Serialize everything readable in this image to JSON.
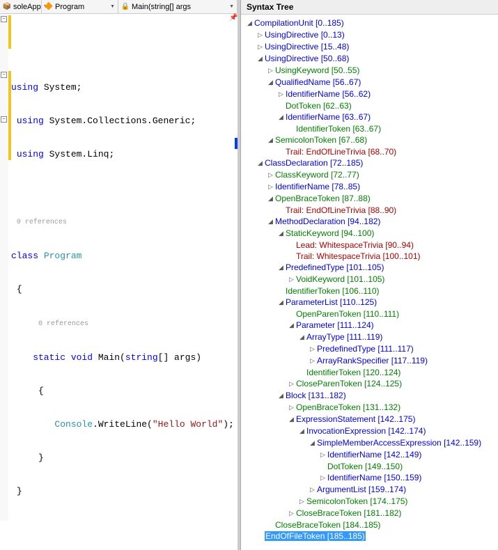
{
  "dropdowns": {
    "project": "soleApp",
    "class": "Program",
    "method": "Main(string[] args"
  },
  "icons": {
    "project": "📦",
    "class": "🔶",
    "method": "🔒",
    "pin": "📌",
    "fold": "−"
  },
  "code": {
    "refcount": "0 references",
    "lines": {
      "u1a": "using",
      "u1b": " System;",
      "u2a": "using",
      "u2b": " System.Collections.Generic;",
      "u3a": "using",
      "u3b": " System.Linq;",
      "cls1": "class",
      "cls2": " Program",
      "ob": "{",
      "m1": "    static",
      "m2": " void",
      "m3": " Main(",
      "m4": "string",
      "m5": "[] args)",
      "mob": "    {",
      "c1": "        Console",
      "c2": ".WriteLine(",
      "c3": "\"Hello World\"",
      "c4": ");",
      "mcb": "    }",
      "cb": "}"
    }
  },
  "panel": {
    "title": "Syntax Tree"
  },
  "tree": [
    {
      "d": 0,
      "e": true,
      "c": "blue",
      "t": "CompilationUnit [0..185)"
    },
    {
      "d": 1,
      "e": false,
      "c": "blue",
      "t": "UsingDirective [0..13)"
    },
    {
      "d": 1,
      "e": false,
      "c": "blue",
      "t": "UsingDirective [15..48)"
    },
    {
      "d": 1,
      "e": true,
      "c": "blue",
      "t": "UsingDirective [50..68)"
    },
    {
      "d": 2,
      "e": false,
      "c": "green",
      "t": "UsingKeyword [50..55)"
    },
    {
      "d": 2,
      "e": true,
      "c": "blue",
      "t": "QualifiedName [56..67)"
    },
    {
      "d": 3,
      "e": false,
      "c": "blue",
      "t": "IdentifierName [56..62)"
    },
    {
      "d": 3,
      "leaf": true,
      "c": "green",
      "t": "DotToken [62..63)"
    },
    {
      "d": 3,
      "e": true,
      "c": "blue",
      "t": "IdentifierName [63..67)"
    },
    {
      "d": 4,
      "leaf": true,
      "c": "green",
      "t": "IdentifierToken [63..67)"
    },
    {
      "d": 2,
      "e": true,
      "c": "green",
      "t": "SemicolonToken [67..68)"
    },
    {
      "d": 3,
      "leaf": true,
      "c": "red",
      "t": "Trail: EndOfLineTrivia [68..70)"
    },
    {
      "d": 1,
      "e": true,
      "c": "blue",
      "t": "ClassDeclaration [72..185)"
    },
    {
      "d": 2,
      "e": false,
      "c": "green",
      "t": "ClassKeyword [72..77)"
    },
    {
      "d": 2,
      "e": false,
      "c": "blue",
      "t": "IdentifierName [78..85)"
    },
    {
      "d": 2,
      "e": true,
      "c": "green",
      "t": "OpenBraceToken [87..88)"
    },
    {
      "d": 3,
      "leaf": true,
      "c": "red",
      "t": "Trail: EndOfLineTrivia [88..90)"
    },
    {
      "d": 2,
      "e": true,
      "c": "blue",
      "t": "MethodDeclaration [94..182)"
    },
    {
      "d": 3,
      "e": true,
      "c": "green",
      "t": "StaticKeyword [94..100)"
    },
    {
      "d": 4,
      "leaf": true,
      "c": "red",
      "t": "Lead: WhitespaceTrivia [90..94)"
    },
    {
      "d": 4,
      "leaf": true,
      "c": "red",
      "t": "Trail: WhitespaceTrivia [100..101)"
    },
    {
      "d": 3,
      "e": true,
      "c": "blue",
      "t": "PredefinedType [101..105)"
    },
    {
      "d": 4,
      "e": false,
      "c": "green",
      "t": "VoidKeyword [101..105)"
    },
    {
      "d": 3,
      "leaf": true,
      "c": "green",
      "t": "IdentifierToken [106..110)"
    },
    {
      "d": 3,
      "e": true,
      "c": "blue",
      "t": "ParameterList [110..125)"
    },
    {
      "d": 4,
      "leaf": true,
      "c": "green",
      "t": "OpenParenToken [110..111)"
    },
    {
      "d": 4,
      "e": true,
      "c": "blue",
      "t": "Parameter [111..124)"
    },
    {
      "d": 5,
      "e": true,
      "c": "blue",
      "t": "ArrayType [111..119)"
    },
    {
      "d": 6,
      "e": false,
      "c": "blue",
      "t": "PredefinedType [111..117)"
    },
    {
      "d": 6,
      "e": false,
      "c": "blue",
      "t": "ArrayRankSpecifier [117..119)"
    },
    {
      "d": 5,
      "leaf": true,
      "c": "green",
      "t": "IdentifierToken [120..124)"
    },
    {
      "d": 4,
      "e": false,
      "c": "green",
      "t": "CloseParenToken [124..125)"
    },
    {
      "d": 3,
      "e": true,
      "c": "blue",
      "t": "Block [131..182)"
    },
    {
      "d": 4,
      "e": false,
      "c": "green",
      "t": "OpenBraceToken [131..132)"
    },
    {
      "d": 4,
      "e": true,
      "c": "blue",
      "t": "ExpressionStatement [142..175)"
    },
    {
      "d": 5,
      "e": true,
      "c": "blue",
      "t": "InvocationExpression [142..174)"
    },
    {
      "d": 6,
      "e": true,
      "c": "blue",
      "t": "SimpleMemberAccessExpression [142..159)"
    },
    {
      "d": 7,
      "e": false,
      "c": "blue",
      "t": "IdentifierName [142..149)"
    },
    {
      "d": 7,
      "leaf": true,
      "c": "green",
      "t": "DotToken [149..150)"
    },
    {
      "d": 7,
      "e": false,
      "c": "blue",
      "t": "IdentifierName [150..159)"
    },
    {
      "d": 6,
      "e": false,
      "c": "blue",
      "t": "ArgumentList [159..174)"
    },
    {
      "d": 5,
      "e": false,
      "c": "green",
      "t": "SemicolonToken [174..175)"
    },
    {
      "d": 4,
      "e": false,
      "c": "green",
      "t": "CloseBraceToken [181..182)"
    },
    {
      "d": 2,
      "leaf": true,
      "c": "green",
      "t": "CloseBraceToken [184..185)"
    },
    {
      "d": 1,
      "leaf": true,
      "c": "green",
      "t": "EndOfFileToken [185..185)",
      "sel": true
    }
  ]
}
